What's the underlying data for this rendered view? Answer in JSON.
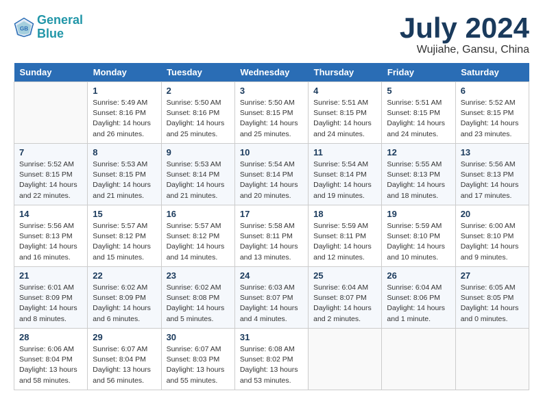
{
  "header": {
    "logo_line1": "General",
    "logo_line2": "Blue",
    "month": "July 2024",
    "location": "Wujiahe, Gansu, China"
  },
  "weekdays": [
    "Sunday",
    "Monday",
    "Tuesday",
    "Wednesday",
    "Thursday",
    "Friday",
    "Saturday"
  ],
  "weeks": [
    [
      {
        "day": "",
        "info": ""
      },
      {
        "day": "1",
        "info": "Sunrise: 5:49 AM\nSunset: 8:16 PM\nDaylight: 14 hours\nand 26 minutes."
      },
      {
        "day": "2",
        "info": "Sunrise: 5:50 AM\nSunset: 8:16 PM\nDaylight: 14 hours\nand 25 minutes."
      },
      {
        "day": "3",
        "info": "Sunrise: 5:50 AM\nSunset: 8:15 PM\nDaylight: 14 hours\nand 25 minutes."
      },
      {
        "day": "4",
        "info": "Sunrise: 5:51 AM\nSunset: 8:15 PM\nDaylight: 14 hours\nand 24 minutes."
      },
      {
        "day": "5",
        "info": "Sunrise: 5:51 AM\nSunset: 8:15 PM\nDaylight: 14 hours\nand 24 minutes."
      },
      {
        "day": "6",
        "info": "Sunrise: 5:52 AM\nSunset: 8:15 PM\nDaylight: 14 hours\nand 23 minutes."
      }
    ],
    [
      {
        "day": "7",
        "info": "Sunrise: 5:52 AM\nSunset: 8:15 PM\nDaylight: 14 hours\nand 22 minutes."
      },
      {
        "day": "8",
        "info": "Sunrise: 5:53 AM\nSunset: 8:15 PM\nDaylight: 14 hours\nand 21 minutes."
      },
      {
        "day": "9",
        "info": "Sunrise: 5:53 AM\nSunset: 8:14 PM\nDaylight: 14 hours\nand 21 minutes."
      },
      {
        "day": "10",
        "info": "Sunrise: 5:54 AM\nSunset: 8:14 PM\nDaylight: 14 hours\nand 20 minutes."
      },
      {
        "day": "11",
        "info": "Sunrise: 5:54 AM\nSunset: 8:14 PM\nDaylight: 14 hours\nand 19 minutes."
      },
      {
        "day": "12",
        "info": "Sunrise: 5:55 AM\nSunset: 8:13 PM\nDaylight: 14 hours\nand 18 minutes."
      },
      {
        "day": "13",
        "info": "Sunrise: 5:56 AM\nSunset: 8:13 PM\nDaylight: 14 hours\nand 17 minutes."
      }
    ],
    [
      {
        "day": "14",
        "info": "Sunrise: 5:56 AM\nSunset: 8:13 PM\nDaylight: 14 hours\nand 16 minutes."
      },
      {
        "day": "15",
        "info": "Sunrise: 5:57 AM\nSunset: 8:12 PM\nDaylight: 14 hours\nand 15 minutes."
      },
      {
        "day": "16",
        "info": "Sunrise: 5:57 AM\nSunset: 8:12 PM\nDaylight: 14 hours\nand 14 minutes."
      },
      {
        "day": "17",
        "info": "Sunrise: 5:58 AM\nSunset: 8:11 PM\nDaylight: 14 hours\nand 13 minutes."
      },
      {
        "day": "18",
        "info": "Sunrise: 5:59 AM\nSunset: 8:11 PM\nDaylight: 14 hours\nand 12 minutes."
      },
      {
        "day": "19",
        "info": "Sunrise: 5:59 AM\nSunset: 8:10 PM\nDaylight: 14 hours\nand 10 minutes."
      },
      {
        "day": "20",
        "info": "Sunrise: 6:00 AM\nSunset: 8:10 PM\nDaylight: 14 hours\nand 9 minutes."
      }
    ],
    [
      {
        "day": "21",
        "info": "Sunrise: 6:01 AM\nSunset: 8:09 PM\nDaylight: 14 hours\nand 8 minutes."
      },
      {
        "day": "22",
        "info": "Sunrise: 6:02 AM\nSunset: 8:09 PM\nDaylight: 14 hours\nand 6 minutes."
      },
      {
        "day": "23",
        "info": "Sunrise: 6:02 AM\nSunset: 8:08 PM\nDaylight: 14 hours\nand 5 minutes."
      },
      {
        "day": "24",
        "info": "Sunrise: 6:03 AM\nSunset: 8:07 PM\nDaylight: 14 hours\nand 4 minutes."
      },
      {
        "day": "25",
        "info": "Sunrise: 6:04 AM\nSunset: 8:07 PM\nDaylight: 14 hours\nand 2 minutes."
      },
      {
        "day": "26",
        "info": "Sunrise: 6:04 AM\nSunset: 8:06 PM\nDaylight: 14 hours\nand 1 minute."
      },
      {
        "day": "27",
        "info": "Sunrise: 6:05 AM\nSunset: 8:05 PM\nDaylight: 14 hours\nand 0 minutes."
      }
    ],
    [
      {
        "day": "28",
        "info": "Sunrise: 6:06 AM\nSunset: 8:04 PM\nDaylight: 13 hours\nand 58 minutes."
      },
      {
        "day": "29",
        "info": "Sunrise: 6:07 AM\nSunset: 8:04 PM\nDaylight: 13 hours\nand 56 minutes."
      },
      {
        "day": "30",
        "info": "Sunrise: 6:07 AM\nSunset: 8:03 PM\nDaylight: 13 hours\nand 55 minutes."
      },
      {
        "day": "31",
        "info": "Sunrise: 6:08 AM\nSunset: 8:02 PM\nDaylight: 13 hours\nand 53 minutes."
      },
      {
        "day": "",
        "info": ""
      },
      {
        "day": "",
        "info": ""
      },
      {
        "day": "",
        "info": ""
      }
    ]
  ]
}
